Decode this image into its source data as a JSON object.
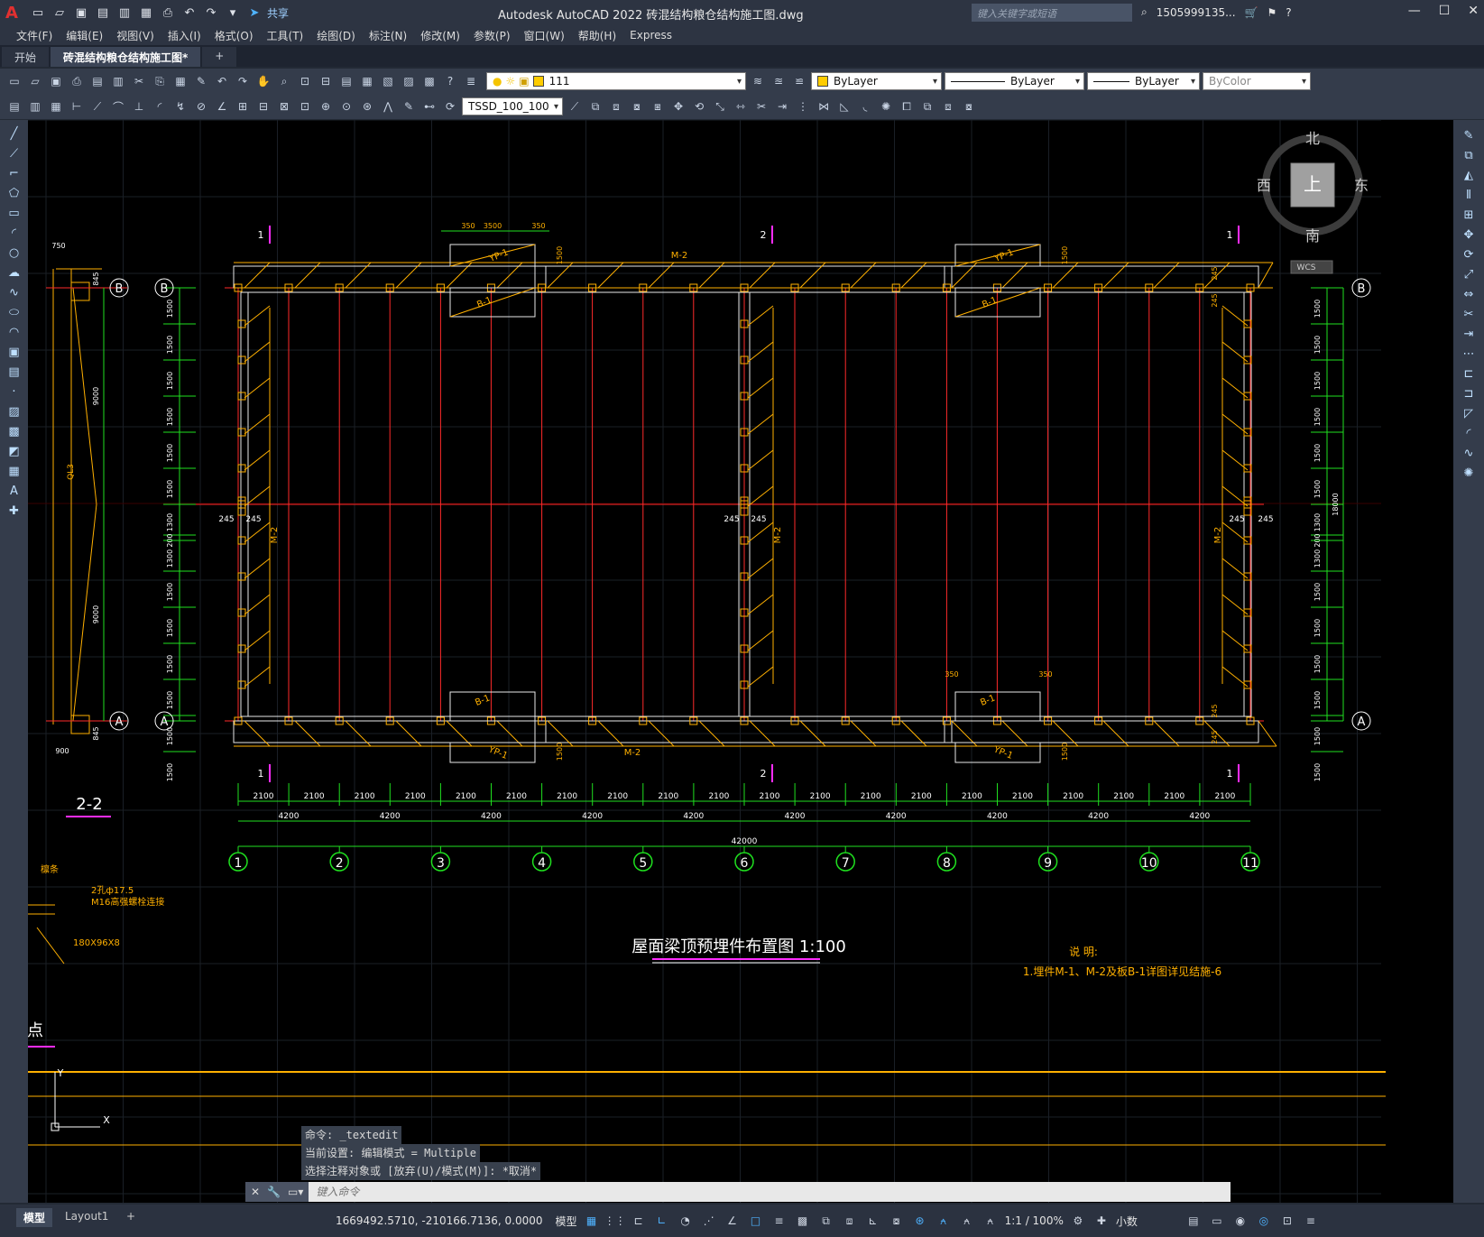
{
  "app": {
    "logo": "A",
    "title": "Autodesk AutoCAD 2022    砖混结构粮仓结构施工图.dwg",
    "search_placeholder": "键入关键字或短语",
    "user": "1505999135...",
    "share_label": "共享"
  },
  "menu": [
    "文件(F)",
    "编辑(E)",
    "视图(V)",
    "插入(I)",
    "格式(O)",
    "工具(T)",
    "绘图(D)",
    "标注(N)",
    "修改(M)",
    "参数(P)",
    "窗口(W)",
    "帮助(H)",
    "Express"
  ],
  "tabs": [
    {
      "label": "开始",
      "active": false
    },
    {
      "label": "砖混结构粮仓结构施工图*",
      "active": true
    }
  ],
  "toolbar": {
    "layer_value": "111",
    "color_value": "ByLayer",
    "linetype_value": "ByLayer",
    "lineweight_value": "ByLayer",
    "plotstyle_value": "ByColor",
    "dimstyle_value": "TSSD_100_100"
  },
  "viewcube": {
    "north": "北",
    "south": "南",
    "east": "东",
    "west": "西",
    "top": "上",
    "wcs": "WCS"
  },
  "drawing": {
    "title": "屋面梁顶预埋件布置图 1:100",
    "section_title": "2-2",
    "note_heading": "说 明:",
    "note_text": "1.埋件M-1、M-2及板B-1详图详见结施-6",
    "partial_label": "点",
    "axis_bubbles": [
      "1",
      "2",
      "3",
      "4",
      "5",
      "6",
      "7",
      "8",
      "9",
      "10",
      "11"
    ],
    "row_bubbles": [
      "A",
      "B"
    ],
    "bay_dims": [
      "2100",
      "2100",
      "2100",
      "2100",
      "2100",
      "2100",
      "2100",
      "2100",
      "2100",
      "2100",
      "2100",
      "2100",
      "2100",
      "2100",
      "2100",
      "2100",
      "2100",
      "2100",
      "2100",
      "2100"
    ],
    "span_dims": [
      "4200",
      "4200",
      "4200",
      "4200",
      "4200",
      "4200",
      "4200",
      "4200",
      "4200",
      "4200"
    ],
    "total_dim": "42000",
    "vert_dims": [
      "1500",
      "1500",
      "1500",
      "1500",
      "1500",
      "1500",
      "1300",
      "200",
      "1300",
      "1500",
      "1500",
      "1500",
      "1500",
      "1500",
      "1500"
    ],
    "labels": {
      "yp": "YP-1",
      "b1": "B-1",
      "m2": "M-2",
      "d350": "350",
      "d3500": "3500",
      "d245": "245",
      "d1500": "1500",
      "d18000": "18000",
      "d9000": "9000",
      "d750": "750",
      "d900": "900",
      "d845": "845",
      "ql3": "QL3"
    },
    "section_cut_labels": [
      "1",
      "2",
      "1",
      "1",
      "2",
      "1"
    ],
    "detail_texts": [
      "檩条",
      "2孔ф17.5",
      "M16高强螺栓连接",
      "180X96X8",
      "40",
      "100",
      "7",
      "0"
    ]
  },
  "command": {
    "history": [
      "命令: _textedit",
      "当前设置: 编辑模式 = Multiple",
      "选择注释对象或 [放弃(U)/模式(M)]: *取消*"
    ],
    "input_placeholder": "键入命令"
  },
  "layouts": [
    "模型",
    "Layout1"
  ],
  "status": {
    "coords": "1669492.5710, -210166.7136, 0.0000",
    "model": "模型",
    "scale": "1:1 / 100%",
    "units": "小数"
  },
  "colors": {
    "bg": "#000000",
    "red": "#ff2a2a",
    "green": "#1fe01f",
    "orange": "#ffb000",
    "white": "#e8e8e8",
    "magenta": "#ff2cff"
  }
}
